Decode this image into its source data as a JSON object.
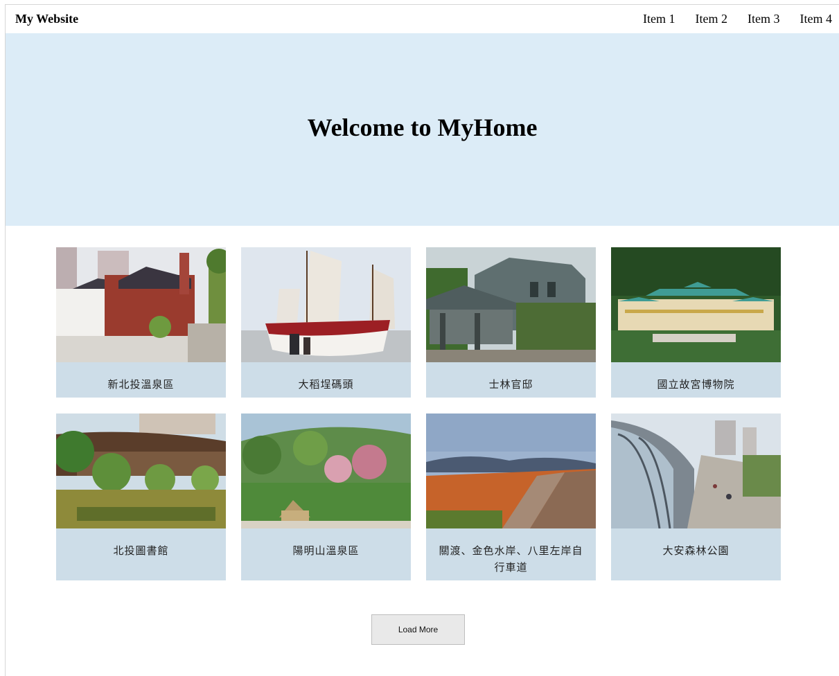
{
  "navbar": {
    "brand": "My Website",
    "items": [
      "Item 1",
      "Item 2",
      "Item 3",
      "Item 4"
    ]
  },
  "hero": {
    "title": "Welcome to MyHome"
  },
  "cards": [
    {
      "label": "新北投溫泉區"
    },
    {
      "label": "大稻埕碼頭"
    },
    {
      "label": "士林官邸"
    },
    {
      "label": "國立故宮博物院"
    },
    {
      "label": "北投圖書館"
    },
    {
      "label": "陽明山溫泉區"
    },
    {
      "label": "關渡、金色水岸、八里左岸自行車道"
    },
    {
      "label": "大安森林公園"
    }
  ],
  "load_more_label": "Load More",
  "colors": {
    "hero_bg": "#dcecf7",
    "card_bg": "#cddde8"
  }
}
